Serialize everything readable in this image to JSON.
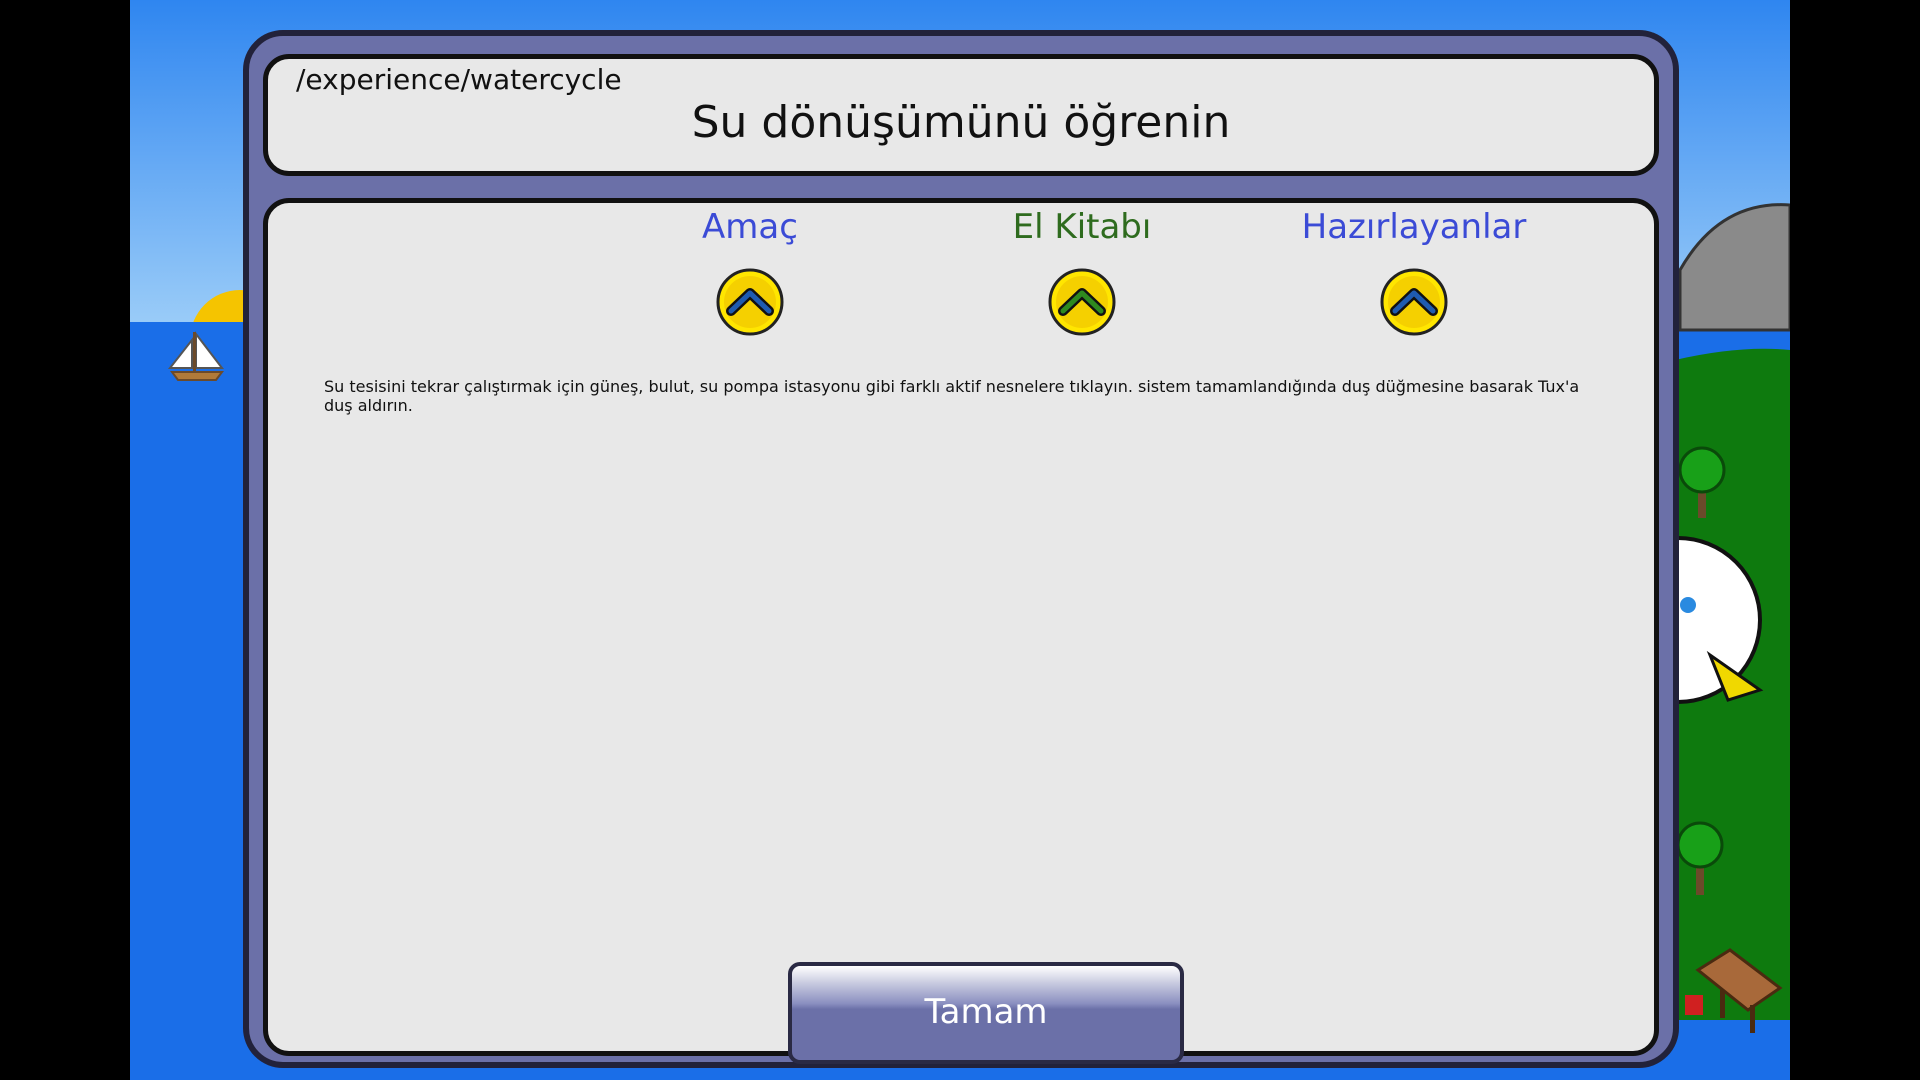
{
  "window": {
    "path": "/experience/watercycle",
    "title": "Su dönüşümünü öğrenin"
  },
  "tabs": [
    {
      "label": "Amaç",
      "color": "#3b4bd6",
      "icon": "chevron-up-icon",
      "icon_color": "#1f5bb0"
    },
    {
      "label": "El Kitabı",
      "color": "#2e6b1e",
      "icon": "chevron-up-icon",
      "icon_color": "#2e8a1f"
    },
    {
      "label": "Hazırlayanlar",
      "color": "#3b4bd6",
      "icon": "chevron-up-icon",
      "icon_color": "#1f5bb0"
    }
  ],
  "description": "Su tesisini tekrar çalıştırmak için güneş, bulut, su pompa istasyonu gibi farklı aktif  nesnelere tıklayın. sistem tamamlandığında duş düğmesine basarak Tux'a duş aldırın.",
  "ok_button": {
    "label": "Tamam"
  },
  "colors": {
    "dialog_frame": "#6b70a8",
    "panel": "#e8e8e8",
    "sea": "#1a6ee8",
    "sky": "#4a9cf0",
    "grass": "#0e7a0e"
  }
}
